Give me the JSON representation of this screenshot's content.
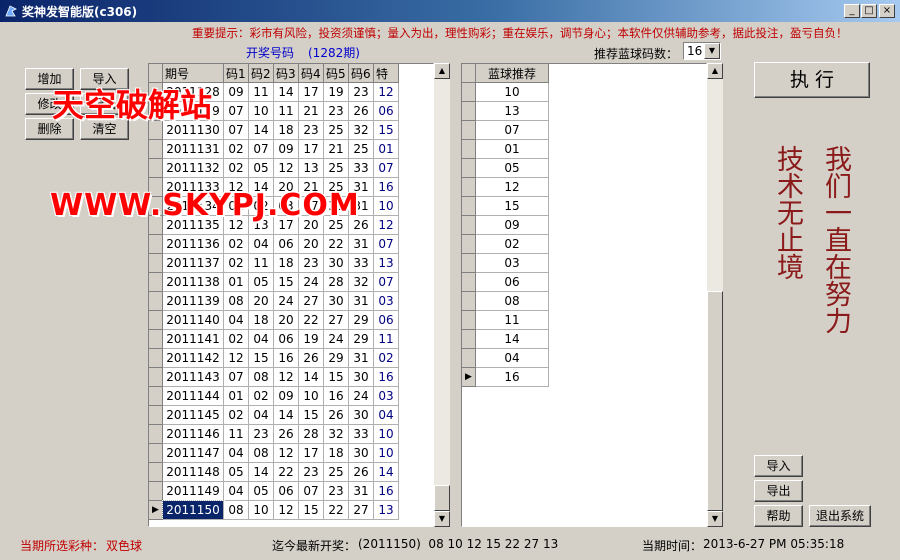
{
  "window": {
    "title": "奖神发智能版(c306)",
    "minimize": "_",
    "maximize": "□",
    "close": "×"
  },
  "notice": "重要提示：彩市有风险，投资须谨慎；量入为出，理性购彩；重在娱乐，调节身心；本软件仅供辅助参考，据此投注，盈亏自负！",
  "left_buttons": {
    "add": "增加",
    "import": "导入",
    "edit": "修改",
    "export": "导出",
    "delete": "删除",
    "clear": "清空"
  },
  "draw_label": "开奖号码",
  "draw_count": "(1282期)",
  "main_table": {
    "headers": [
      "期号",
      "码1",
      "码2",
      "码3",
      "码4",
      "码5",
      "码6",
      "特"
    ],
    "rows": [
      [
        "2011128",
        "09",
        "11",
        "14",
        "17",
        "19",
        "23",
        "12"
      ],
      [
        "2011129",
        "07",
        "10",
        "11",
        "21",
        "23",
        "26",
        "06"
      ],
      [
        "2011130",
        "07",
        "14",
        "18",
        "23",
        "25",
        "32",
        "15"
      ],
      [
        "2011131",
        "02",
        "07",
        "09",
        "17",
        "21",
        "25",
        "01"
      ],
      [
        "2011132",
        "02",
        "05",
        "12",
        "13",
        "25",
        "33",
        "07"
      ],
      [
        "2011133",
        "12",
        "14",
        "20",
        "21",
        "25",
        "31",
        "16"
      ],
      [
        "2011134",
        "01",
        "02",
        "03",
        "07",
        "30",
        "31",
        "10"
      ],
      [
        "2011135",
        "12",
        "13",
        "17",
        "20",
        "25",
        "26",
        "12"
      ],
      [
        "2011136",
        "02",
        "04",
        "06",
        "20",
        "22",
        "31",
        "07"
      ],
      [
        "2011137",
        "02",
        "11",
        "18",
        "23",
        "30",
        "33",
        "13"
      ],
      [
        "2011138",
        "01",
        "05",
        "15",
        "24",
        "28",
        "32",
        "07"
      ],
      [
        "2011139",
        "08",
        "20",
        "24",
        "27",
        "30",
        "31",
        "03"
      ],
      [
        "2011140",
        "04",
        "18",
        "20",
        "22",
        "27",
        "29",
        "06"
      ],
      [
        "2011141",
        "02",
        "04",
        "06",
        "19",
        "24",
        "29",
        "11"
      ],
      [
        "2011142",
        "12",
        "15",
        "16",
        "26",
        "29",
        "31",
        "02"
      ],
      [
        "2011143",
        "07",
        "08",
        "12",
        "14",
        "15",
        "30",
        "16"
      ],
      [
        "2011144",
        "01",
        "02",
        "09",
        "10",
        "16",
        "24",
        "03"
      ],
      [
        "2011145",
        "02",
        "04",
        "14",
        "15",
        "26",
        "30",
        "04"
      ],
      [
        "2011146",
        "11",
        "23",
        "26",
        "28",
        "32",
        "33",
        "10"
      ],
      [
        "2011147",
        "04",
        "08",
        "12",
        "17",
        "18",
        "30",
        "10"
      ],
      [
        "2011148",
        "05",
        "14",
        "22",
        "23",
        "25",
        "26",
        "14"
      ],
      [
        "2011149",
        "04",
        "05",
        "06",
        "07",
        "23",
        "31",
        "16"
      ],
      [
        "2011150",
        "08",
        "10",
        "12",
        "15",
        "22",
        "27",
        "13"
      ]
    ],
    "selected_row": 22
  },
  "recommend_label": "推荐蓝球码数：",
  "recommend_value": "16",
  "blue_table": {
    "header": "蓝球推荐",
    "values": [
      "10",
      "13",
      "07",
      "01",
      "05",
      "12",
      "15",
      "09",
      "02",
      "03",
      "06",
      "08",
      "11",
      "14",
      "04",
      "16"
    ],
    "current_row": 15
  },
  "execute_label": "执 行",
  "motto": {
    "col1": "我们一直在努力",
    "col2": "技术无止境"
  },
  "right_buttons": {
    "import": "导入",
    "export": "导出",
    "help": "帮助",
    "exit": "退出系统"
  },
  "status": {
    "lottery_label": "当期所选彩种：",
    "lottery_value": "双色球",
    "latest_label": "迄今最新开奖：",
    "latest_value": "(2011150)  08 10 12 15 22 27 13",
    "time_label": "当期时间：",
    "time_value": "2013-6-27 PM 05:35:18"
  },
  "watermark": {
    "cn": "天空破解站",
    "url": "WWW.SKYPJ.COM"
  }
}
